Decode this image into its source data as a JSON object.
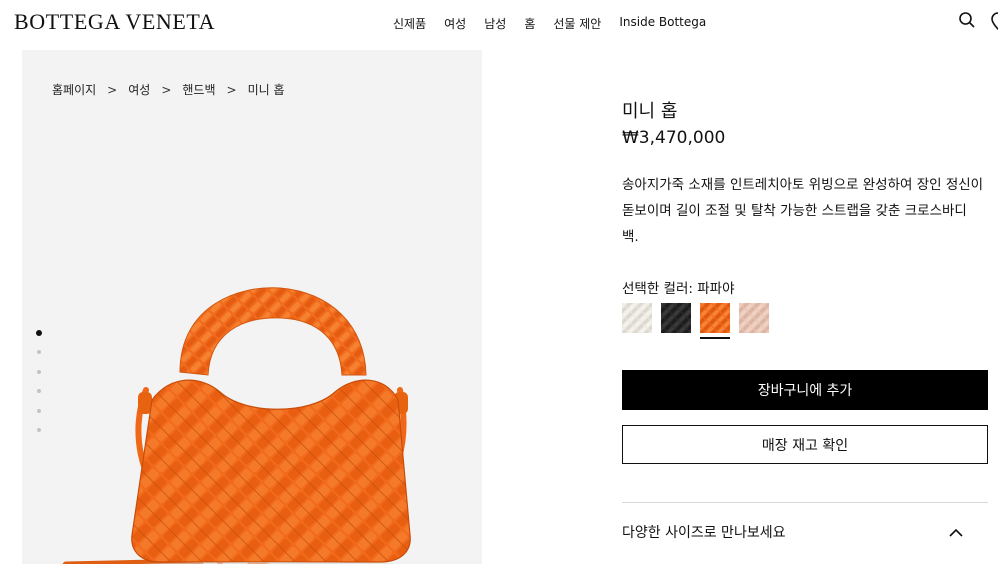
{
  "header": {
    "logo": "BOTTEGA VENETA",
    "nav": [
      "신제품",
      "여성",
      "남성",
      "홈",
      "선물 제안",
      "Inside Bottega"
    ]
  },
  "gallery": {
    "breadcrumb": [
      "홈페이지",
      "여성",
      "핸드백",
      "미니 홉"
    ],
    "separator": ">",
    "image_count": 6,
    "active_index": 0
  },
  "product": {
    "title": "미니 홉",
    "price": "₩3,470,000",
    "description": "송아지가죽 소재를 인트레치아토 위빙으로 완성하여 장인 정신이 돋보이며 길이 조절 및 탈착 가능한 스트랩을 갖춘 크로스바디 백.",
    "color_label": "선택한 컬러: 파파야",
    "swatches": [
      {
        "name": "white",
        "color": "#ebe8e1"
      },
      {
        "name": "black",
        "color": "#2b2b2b"
      },
      {
        "name": "papaya",
        "color": "#f26a1b",
        "selected": true
      },
      {
        "name": "pink",
        "color": "#e8c5b4"
      }
    ],
    "add_to_cart": "장바구니에 추가",
    "check_stock": "매장 재고 확인",
    "sizes_accordion": "다양한 사이즈로 만나보세요"
  },
  "colors": {
    "bag_orange": "#f26a1b",
    "gallery_bg": "#f2f3f2",
    "primary_button": "#000000"
  }
}
